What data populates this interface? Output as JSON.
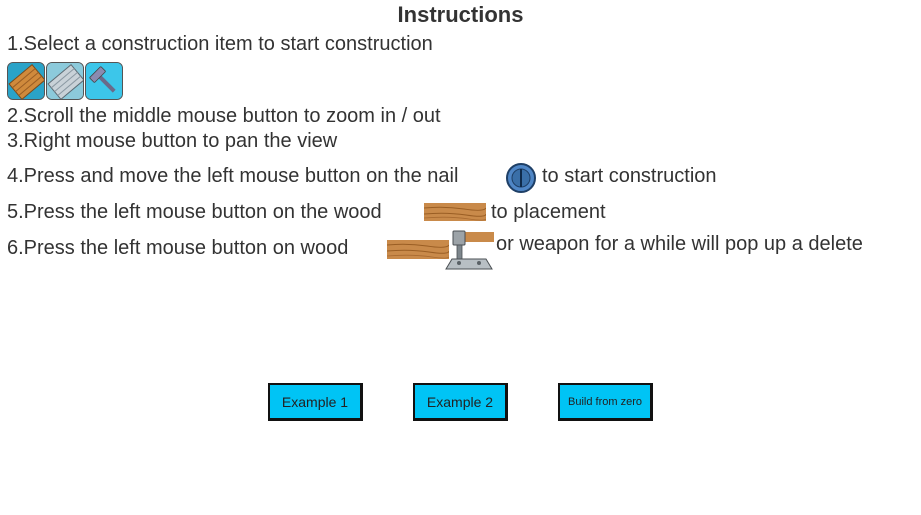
{
  "title": "Instructions",
  "steps": {
    "s1": "1.Select a construction item to start construction",
    "s2": "2.Scroll the middle mouse button to zoom in / out",
    "s3": "3.Right mouse button to pan the view",
    "s4_pre": "4.Press and move the left mouse button on the nail",
    "s4_post": "to start construction",
    "s5_pre": "5.Press the left mouse button on the wood",
    "s5_post": "to placement",
    "s6_pre": "6.Press the left mouse button on wood",
    "s6_post": "or weapon for a while will pop up a delete"
  },
  "items": [
    "wood-plank-item-icon",
    "steel-plate-item-icon",
    "hammer-weapon-item-icon"
  ],
  "buttons": {
    "example1": "Example 1",
    "example2": "Example 2",
    "build": "Build from  zero"
  },
  "colors": {
    "button_bg": "#00c4f5",
    "wood": "#c98a4a",
    "nail": "#4f86c6"
  }
}
